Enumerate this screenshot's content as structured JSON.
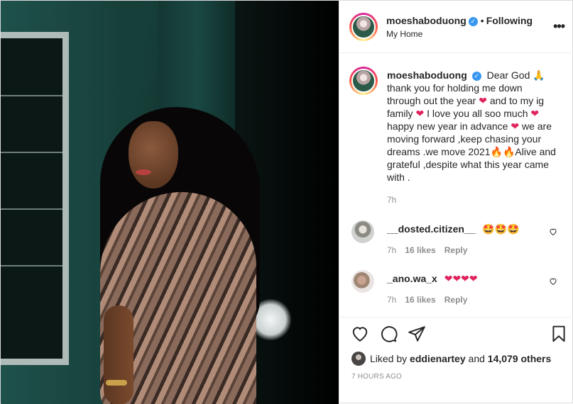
{
  "header": {
    "username": "moeshaboduong",
    "separator": "•",
    "follow_status": "Following",
    "location": "My Home",
    "more_glyph": "•••"
  },
  "caption": {
    "username": "moeshaboduong",
    "segments": [
      "Dear God 🙏",
      "thank you for holding me down through out the year",
      "and to my ig family",
      "I love you all soo much",
      "happy new year in advance",
      "we are moving forward ,keep chasing your dreams .we move 2021🔥🔥Alive and grateful ,despite what this year came with ."
    ],
    "heart": "❤",
    "time": "7h"
  },
  "comments": [
    {
      "username": "__dosted.citizen__",
      "text": "🤩🤩🤩",
      "time": "7h",
      "likes": "16 likes",
      "reply": "Reply"
    },
    {
      "username": "_ano.wa_x",
      "text": "❤❤❤❤",
      "time": "7h",
      "likes": "16 likes",
      "reply": "Reply"
    }
  ],
  "likes": {
    "prefix": "Liked by",
    "user": "eddienartey",
    "and": "and",
    "others": "14,079 others"
  },
  "timestamp": "7 HOURS AGO",
  "icons": {
    "verified": "✓",
    "like": "heart-outline-icon",
    "comment": "comment-icon",
    "share": "share-icon",
    "save": "bookmark-icon"
  },
  "colors": {
    "verified": "#3897f0",
    "heart": "#e0245e",
    "muted": "#8e8e8e",
    "text": "#262626"
  }
}
